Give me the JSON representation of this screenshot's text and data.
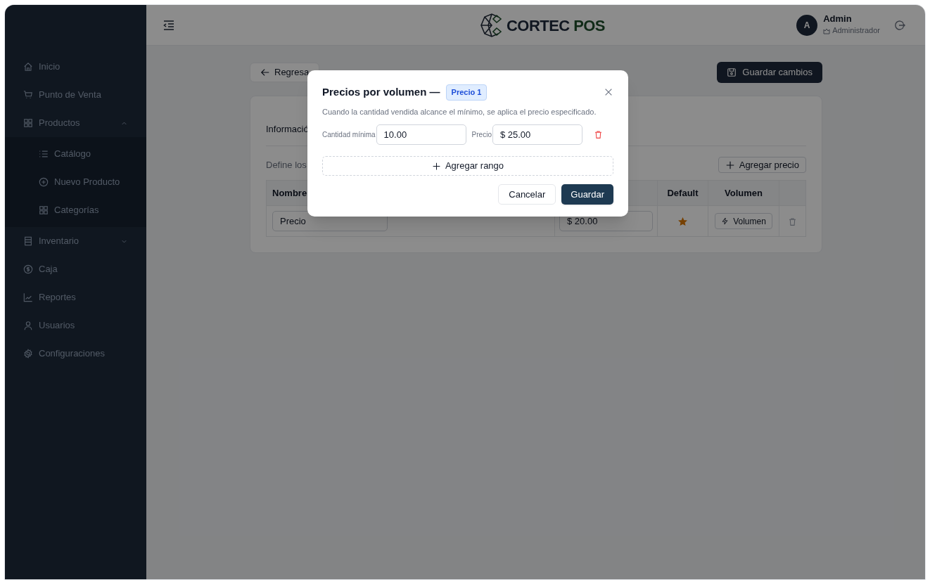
{
  "header": {
    "logo_text": "CORTEC",
    "logo_accent": "POS",
    "user_initial": "A",
    "user_name": "Admin",
    "user_role": "Administrador"
  },
  "sidebar": {
    "items": [
      {
        "label": "Inicio"
      },
      {
        "label": "Punto de Venta"
      },
      {
        "label": "Productos",
        "expanded": true,
        "children": [
          {
            "label": "Catálogo"
          },
          {
            "label": "Nuevo Producto"
          },
          {
            "label": "Categorías"
          }
        ]
      },
      {
        "label": "Inventario",
        "expanded": false
      },
      {
        "label": "Caja"
      },
      {
        "label": "Reportes"
      },
      {
        "label": "Usuarios"
      },
      {
        "label": "Configuraciones"
      }
    ]
  },
  "page": {
    "back_button": "Regresa",
    "save_button": "Guardar cambios",
    "tab": "Informació",
    "description": "Define los",
    "add_price_button": "Agregar precio",
    "table": {
      "columns": [
        "Nombre",
        "Default",
        "Volumen"
      ],
      "rows": [
        {
          "name": "Precio",
          "price": "$ 20.00",
          "default": true,
          "volume_button": "Volumen"
        }
      ]
    }
  },
  "modal": {
    "title": "Precios por volumen —",
    "badge": "Precio 1",
    "description": "Cuando la cantidad vendida alcance el mínimo, se aplica el precio especificado.",
    "ranges": [
      {
        "min_label": "Cantidad mínima",
        "min_value": "10.00",
        "price_label": "Precio",
        "price_value": "$ 25.00"
      }
    ],
    "add_range_button": "Agregar rango",
    "cancel_button": "Cancelar",
    "save_button": "Guardar"
  }
}
